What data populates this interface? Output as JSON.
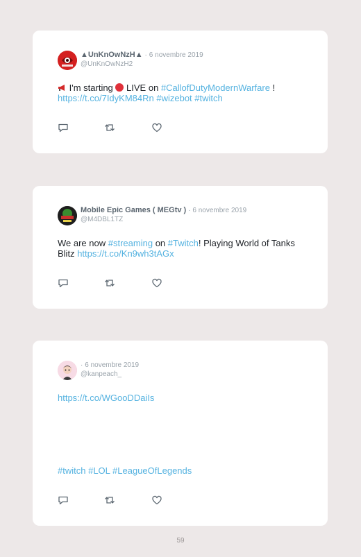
{
  "tweets": [
    {
      "name": "▲UnKnOwNzH▲",
      "separator": "·",
      "date": "6 novembre 2019",
      "handle": "@UnKnOwNzH2",
      "line1_pre": "I'm starting",
      "line1_mid": "LIVE on",
      "hashtag_cod": "#CallofDutyModernWarfare",
      "line1_end": "!",
      "link": "https://t.co/7IdyKM84Rn",
      "hashtag_wizebot": "#wizebot",
      "hashtag_twitch": "#twitch",
      "avatar_color": "#d42020"
    },
    {
      "name": "Mobile Epic Games ( MEGtv )",
      "separator": "·",
      "date": "6 novembre 2019",
      "handle": "@M4DBL1TZ",
      "text_1": "We are now",
      "hashtag_streaming": "#streaming",
      "text_2": "on",
      "hashtag_twitch": "#Twitch",
      "text_3": "! Playing World of Tanks",
      "text_4": "Blitz",
      "link": "https://t.co/Kn9wh3tAGx",
      "avatar_color": "#222222"
    },
    {
      "separator": "·",
      "date": "6 novembre 2019",
      "handle": "@kanpeach_",
      "link": "https://t.co/WGooDDaiIs",
      "hashtag_twitch": "#twitch",
      "hashtag_lol": "#LOL",
      "hashtag_league": "#LeagueOfLegends",
      "avatar_color": "#f3c6d6"
    }
  ],
  "icons": [
    "megaphone-icon",
    "red-circle-icon",
    "reply-icon",
    "retweet-icon",
    "like-icon"
  ],
  "page_number": "59",
  "colors": {
    "link": "#54b2e0",
    "name": "#5b6670",
    "meta": "#9aa3ab",
    "background": "#ede8e8"
  }
}
